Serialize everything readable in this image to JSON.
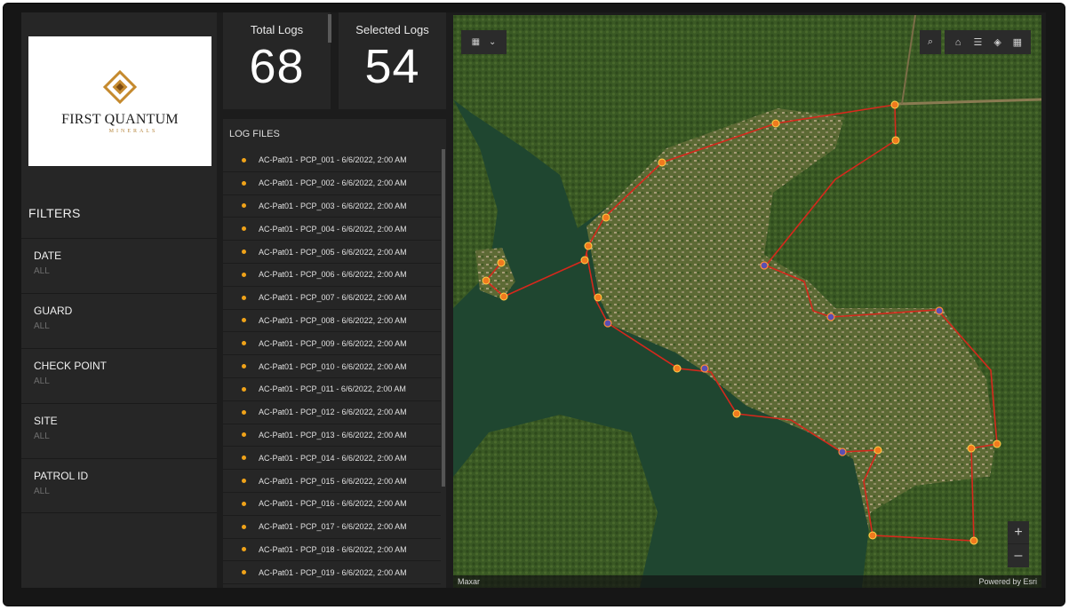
{
  "brand": {
    "name": "FIRST QUANTUM",
    "subtitle": "MINERALS",
    "colors": {
      "logo_gold": "#c58a2e",
      "logo_dark": "#7a4a12"
    }
  },
  "filters": {
    "title": "FILTERS",
    "items": [
      {
        "label": "DATE",
        "value": "ALL"
      },
      {
        "label": "GUARD",
        "value": "ALL"
      },
      {
        "label": "CHECK POINT",
        "value": "ALL"
      },
      {
        "label": "SITE",
        "value": "ALL"
      },
      {
        "label": "PATROL ID",
        "value": "ALL"
      }
    ]
  },
  "kpis": {
    "total": {
      "label": "Total Logs",
      "value": "68"
    },
    "selected": {
      "label": "Selected Logs",
      "value": "54"
    }
  },
  "logs": {
    "title": "LOG FILES",
    "dot_color": "#f0a319",
    "items": [
      "AC-Pat01 - PCP_001 - 6/6/2022, 2:00 AM",
      "AC-Pat01 - PCP_002 - 6/6/2022, 2:00 AM",
      "AC-Pat01 - PCP_003 - 6/6/2022, 2:00 AM",
      "AC-Pat01 - PCP_004 - 6/6/2022, 2:00 AM",
      "AC-Pat01 - PCP_005 - 6/6/2022, 2:00 AM",
      "AC-Pat01 - PCP_006 - 6/6/2022, 2:00 AM",
      "AC-Pat01 - PCP_007 - 6/6/2022, 2:00 AM",
      "AC-Pat01 - PCP_008 - 6/6/2022, 2:00 AM",
      "AC-Pat01 - PCP_009 - 6/6/2022, 2:00 AM",
      "AC-Pat01 - PCP_010 - 6/6/2022, 2:00 AM",
      "AC-Pat01 - PCP_011 - 6/6/2022, 2:00 AM",
      "AC-Pat01 - PCP_012 - 6/6/2022, 2:00 AM",
      "AC-Pat01 - PCP_013 - 6/6/2022, 2:00 AM",
      "AC-Pat01 - PCP_014 - 6/6/2022, 2:00 AM",
      "AC-Pat01 - PCP_015 - 6/6/2022, 2:00 AM",
      "AC-Pat01 - PCP_016 - 6/6/2022, 2:00 AM",
      "AC-Pat01 - PCP_017 - 6/6/2022, 2:00 AM",
      "AC-Pat01 - PCP_018 - 6/6/2022, 2:00 AM",
      "AC-Pat01 - PCP_019 - 6/6/2022, 2:00 AM"
    ]
  },
  "map": {
    "attribution_left": "Maxar",
    "attribution_right": "Powered by Esri",
    "zoom_in": "+",
    "zoom_out": "–",
    "icons": [
      "widget-icon",
      "chevron-down-icon",
      "search-icon",
      "home-icon",
      "list-icon",
      "layers-icon",
      "basemap-gallery-icon"
    ],
    "colors": {
      "route": "#d6281c",
      "checkpoint": "#f07a1e",
      "checkpoint_alt": "#5b4fb3",
      "water": "#1f4a31",
      "forest": "#3b5a26",
      "town": "#7e7d4e"
    }
  }
}
